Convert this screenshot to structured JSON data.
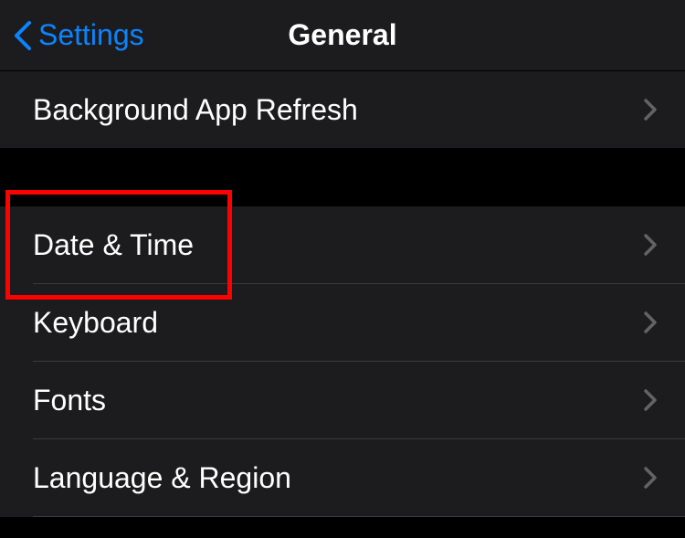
{
  "nav": {
    "back_label": "Settings",
    "title": "General"
  },
  "groups": [
    {
      "rows": [
        {
          "label": "Background App Refresh"
        }
      ]
    },
    {
      "rows": [
        {
          "label": "Date & Time"
        },
        {
          "label": "Keyboard"
        },
        {
          "label": "Fonts"
        },
        {
          "label": "Language & Region"
        }
      ]
    }
  ]
}
